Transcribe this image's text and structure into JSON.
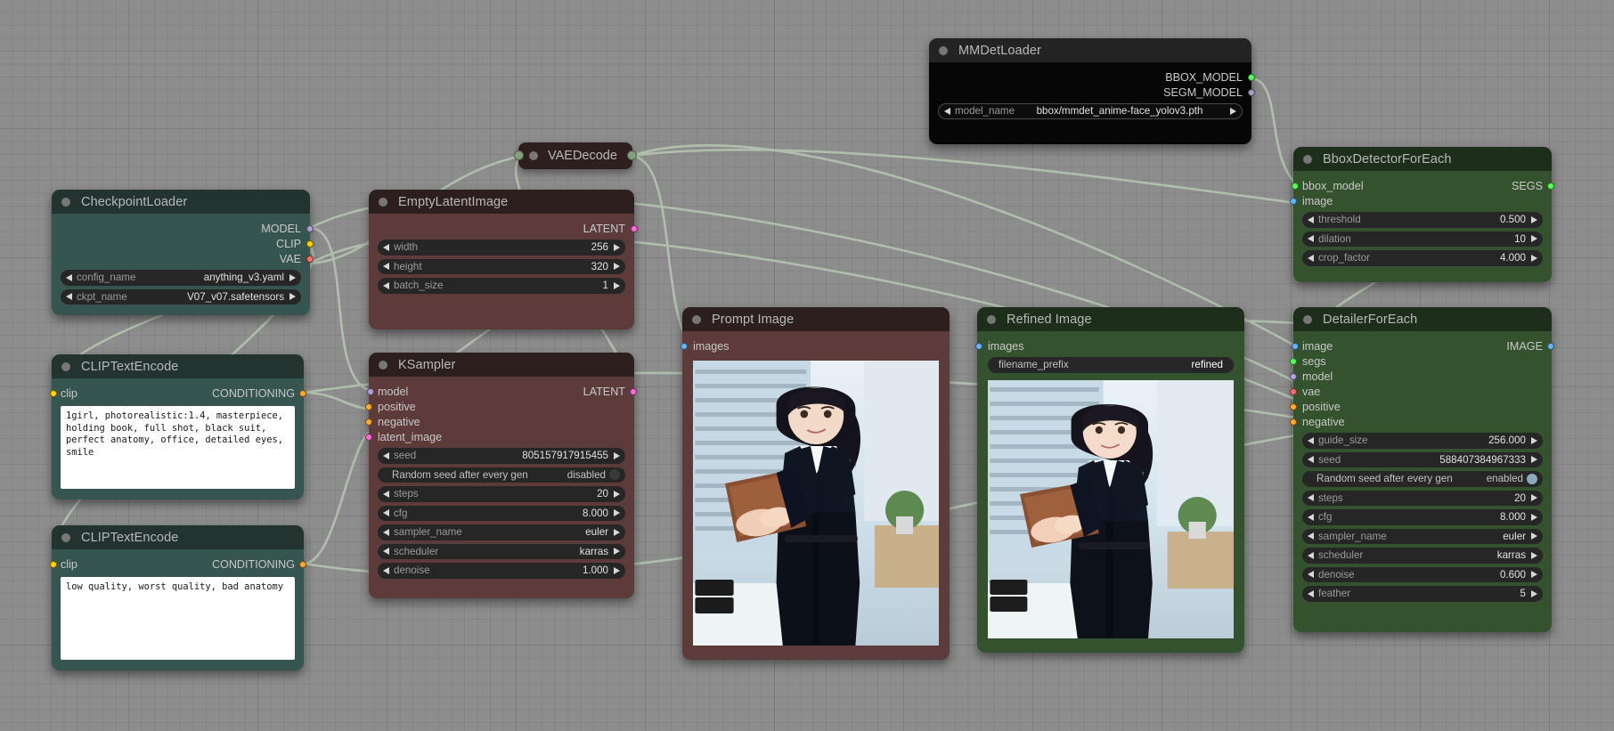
{
  "canvas": {
    "background": "#8d8d8d",
    "grid": true
  },
  "slot_colors": {
    "MODEL": "#b39ddb",
    "CLIP": "#ffd500",
    "VAE": "#ff6e6e",
    "CONDITIONING": "#ffa931",
    "LATENT": "#ff6ad5",
    "IMAGE": "#64b5f6",
    "SEGS": "#57ff57",
    "BBOX_MODEL": "#57ff57",
    "SEGM_MODEL": "#a0a0c0"
  },
  "nodes": [
    {
      "id": "checkpointloader",
      "title": "CheckpointLoader",
      "theme": "teal",
      "outputs": [
        {
          "label": "MODEL",
          "type": "MODEL"
        },
        {
          "label": "CLIP",
          "type": "CLIP"
        },
        {
          "label": "VAE",
          "type": "VAE"
        }
      ],
      "widgets": [
        {
          "name": "config_name",
          "value": "anything_v3.yaml",
          "kind": "combo"
        },
        {
          "name": "ckpt_name",
          "value": "V07_v07.safetensors",
          "kind": "combo"
        }
      ]
    },
    {
      "id": "cliptextencode-positive",
      "title": "CLIPTextEncode",
      "theme": "teal",
      "inputs": [
        {
          "label": "clip",
          "type": "CLIP"
        }
      ],
      "outputs": [
        {
          "label": "CONDITIONING",
          "type": "CONDITIONING"
        }
      ],
      "text": "1girl, photorealistic:1.4, masterpiece, holding book, full shot, black suit, perfect anatomy, office, detailed eyes, smile"
    },
    {
      "id": "cliptextencode-negative",
      "title": "CLIPTextEncode",
      "theme": "teal",
      "inputs": [
        {
          "label": "clip",
          "type": "CLIP"
        }
      ],
      "outputs": [
        {
          "label": "CONDITIONING",
          "type": "CONDITIONING"
        }
      ],
      "text": "low quality, worst quality, bad anatomy"
    },
    {
      "id": "emptylatentimage",
      "title": "EmptyLatentImage",
      "theme": "red",
      "outputs": [
        {
          "label": "LATENT",
          "type": "LATENT"
        }
      ],
      "widgets": [
        {
          "name": "width",
          "value": "256",
          "kind": "combo"
        },
        {
          "name": "height",
          "value": "320",
          "kind": "combo"
        },
        {
          "name": "batch_size",
          "value": "1",
          "kind": "combo"
        }
      ]
    },
    {
      "id": "ksampler",
      "title": "KSampler",
      "theme": "red",
      "inputs": [
        {
          "label": "model",
          "type": "MODEL"
        },
        {
          "label": "positive",
          "type": "CONDITIONING"
        },
        {
          "label": "negative",
          "type": "CONDITIONING"
        },
        {
          "label": "latent_image",
          "type": "LATENT"
        }
      ],
      "outputs": [
        {
          "label": "LATENT",
          "type": "LATENT"
        }
      ],
      "widgets": [
        {
          "name": "seed",
          "value": "805157917915455",
          "kind": "combo"
        },
        {
          "name": "Random seed after every gen",
          "value": "disabled",
          "kind": "toggle",
          "knob": "#3a3a3a"
        },
        {
          "name": "steps",
          "value": "20",
          "kind": "combo"
        },
        {
          "name": "cfg",
          "value": "8.000",
          "kind": "combo"
        },
        {
          "name": "sampler_name",
          "value": "euler",
          "kind": "combo"
        },
        {
          "name": "scheduler",
          "value": "karras",
          "kind": "combo"
        },
        {
          "name": "denoise",
          "value": "1.000",
          "kind": "combo"
        }
      ]
    },
    {
      "id": "vaedecode",
      "title": "VAEDecode",
      "theme": "red",
      "collapsed": true
    },
    {
      "id": "mmdetloader",
      "title": "MMDetLoader",
      "theme": "black",
      "outputs": [
        {
          "label": "BBOX_MODEL",
          "type": "BBOX_MODEL"
        },
        {
          "label": "SEGM_MODEL",
          "type": "SEGM_MODEL"
        }
      ],
      "widgets": [
        {
          "name": "model_name",
          "value": "bbox/mmdet_anime-face_yolov3.pth",
          "kind": "combo"
        }
      ]
    },
    {
      "id": "promptimage",
      "title": "Prompt Image",
      "theme": "red",
      "inputs": [
        {
          "label": "images",
          "type": "IMAGE"
        }
      ],
      "image": "office-woman-holding-book"
    },
    {
      "id": "refinedimage",
      "title": "Refined Image",
      "theme": "green",
      "inputs": [
        {
          "label": "images",
          "type": "IMAGE"
        }
      ],
      "widgets": [
        {
          "name": "filename_prefix",
          "value": "refined",
          "kind": "text"
        }
      ],
      "image": "office-woman-holding-book-refined"
    },
    {
      "id": "bboxdetectorforeach",
      "title": "BboxDetectorForEach",
      "theme": "green",
      "inputs": [
        {
          "label": "bbox_model",
          "type": "BBOX_MODEL"
        },
        {
          "label": "image",
          "type": "IMAGE"
        }
      ],
      "outputs": [
        {
          "label": "SEGS",
          "type": "SEGS"
        }
      ],
      "widgets": [
        {
          "name": "threshold",
          "value": "0.500",
          "kind": "combo"
        },
        {
          "name": "dilation",
          "value": "10",
          "kind": "combo"
        },
        {
          "name": "crop_factor",
          "value": "4.000",
          "kind": "combo"
        }
      ]
    },
    {
      "id": "detailerforeach",
      "title": "DetailerForEach",
      "theme": "green",
      "inputs": [
        {
          "label": "image",
          "type": "IMAGE"
        },
        {
          "label": "segs",
          "type": "SEGS"
        },
        {
          "label": "model",
          "type": "MODEL"
        },
        {
          "label": "vae",
          "type": "VAE"
        },
        {
          "label": "positive",
          "type": "CONDITIONING"
        },
        {
          "label": "negative",
          "type": "CONDITIONING"
        }
      ],
      "outputs": [
        {
          "label": "IMAGE",
          "type": "IMAGE"
        }
      ],
      "widgets": [
        {
          "name": "guide_size",
          "value": "256.000",
          "kind": "combo"
        },
        {
          "name": "seed",
          "value": "588407384967333",
          "kind": "combo"
        },
        {
          "name": "Random seed after every gen",
          "value": "enabled",
          "kind": "toggle",
          "knob": "#8fa8bd"
        },
        {
          "name": "steps",
          "value": "20",
          "kind": "combo"
        },
        {
          "name": "cfg",
          "value": "8.000",
          "kind": "combo"
        },
        {
          "name": "sampler_name",
          "value": "euler",
          "kind": "combo"
        },
        {
          "name": "scheduler",
          "value": "karras",
          "kind": "combo"
        },
        {
          "name": "denoise",
          "value": "0.600",
          "kind": "combo"
        },
        {
          "name": "feather",
          "value": "5",
          "kind": "combo"
        }
      ]
    }
  ]
}
